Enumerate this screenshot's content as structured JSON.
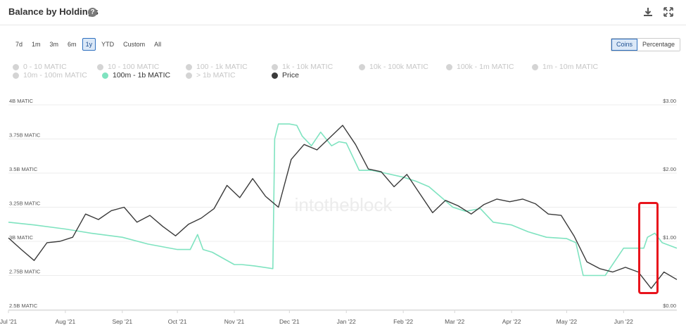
{
  "header": {
    "title": "Balance by Holdings",
    "help_icon": "question-circle-icon",
    "download_icon": "download-icon",
    "expand_icon": "expand-icon"
  },
  "periods": [
    "7d",
    "1m",
    "3m",
    "6m",
    "1y",
    "YTD",
    "Custom",
    "All"
  ],
  "active_period": "1y",
  "modes": [
    "Coins",
    "Percentage"
  ],
  "active_mode": "Coins",
  "legend": [
    {
      "label": "0 - 10 MATIC",
      "active": false
    },
    {
      "label": "10 - 100 MATIC",
      "active": false
    },
    {
      "label": "100 - 1k MATIC",
      "active": false
    },
    {
      "label": "1k - 10k MATIC",
      "active": false
    },
    {
      "label": "10k - 100k MATIC",
      "active": false
    },
    {
      "label": "100k - 1m MATIC",
      "active": false
    },
    {
      "label": "1m - 10m MATIC",
      "active": false
    },
    {
      "label": "10m - 100m MATIC",
      "active": false
    },
    {
      "label": "100m - 1b MATIC",
      "active": true
    },
    {
      "label": "> 1b MATIC",
      "active": false
    },
    {
      "label": "Price",
      "active": true
    }
  ],
  "watermark": "intotheblock",
  "colors": {
    "holdings_line": "#7fe3c0",
    "price_line": "#3a3a3a",
    "highlight_box": "#e8141c",
    "active_accent": "#2d6fbf"
  },
  "chart_data": {
    "type": "line",
    "x_tick_labels": [
      "Jul '21",
      "Aug '21",
      "Sep '21",
      "Oct '21",
      "Nov '21",
      "Dec '21",
      "Jan '22",
      "Feb '22",
      "Mar '22",
      "Apr '22",
      "May '22",
      "Jun '22"
    ],
    "x_range": [
      "2021-07-01",
      "2022-06-30"
    ],
    "y_left_tick_labels": [
      "4B MATIC",
      "3.75B MATIC",
      "3.5B MATIC",
      "3.25B MATIC",
      "3B MATIC",
      "2.75B MATIC",
      "2.5B MATIC"
    ],
    "y_left_ticks": [
      4,
      3.75,
      3.5,
      3.25,
      3,
      2.75,
      2.5
    ],
    "y_left_range": [
      2.5,
      4
    ],
    "y_right_tick_labels": [
      "$3.00",
      "$2.00",
      "$1.00",
      "$0.00"
    ],
    "y_right_ticks": [
      3,
      2,
      1,
      0
    ],
    "y_right_range": [
      0,
      3
    ],
    "grid": "horizontal",
    "series": [
      {
        "name": "100m - 1b MATIC",
        "axis": "left",
        "x": [
          "2021-07-01",
          "2021-07-15",
          "2021-08-01",
          "2021-08-15",
          "2021-09-01",
          "2021-09-15",
          "2021-10-01",
          "2021-10-08",
          "2021-10-12",
          "2021-10-15",
          "2021-10-20",
          "2021-11-01",
          "2021-11-05",
          "2021-11-12",
          "2021-11-22",
          "2021-11-23",
          "2021-11-25",
          "2021-12-01",
          "2021-12-05",
          "2021-12-08",
          "2021-12-13",
          "2021-12-18",
          "2021-12-24",
          "2021-12-28",
          "2022-01-01",
          "2022-01-08",
          "2022-01-15",
          "2022-01-22",
          "2022-02-01",
          "2022-02-08",
          "2022-02-15",
          "2022-02-28",
          "2022-03-07",
          "2022-03-15",
          "2022-03-22",
          "2022-04-01",
          "2022-04-10",
          "2022-04-20",
          "2022-05-01",
          "2022-05-06",
          "2022-05-10",
          "2022-05-15",
          "2022-05-22",
          "2022-06-01",
          "2022-06-08",
          "2022-06-12",
          "2022-06-14",
          "2022-06-18",
          "2022-06-22",
          "2022-06-30"
        ],
        "y": [
          3.14,
          3.12,
          3.09,
          3.06,
          3.03,
          2.98,
          2.94,
          2.94,
          3.05,
          2.94,
          2.92,
          2.83,
          2.83,
          2.82,
          2.8,
          3.75,
          3.86,
          3.86,
          3.85,
          3.77,
          3.7,
          3.8,
          3.7,
          3.73,
          3.72,
          3.52,
          3.52,
          3.5,
          3.47,
          3.44,
          3.4,
          3.25,
          3.22,
          3.24,
          3.14,
          3.12,
          3.07,
          3.03,
          3.02,
          2.99,
          2.75,
          2.75,
          2.75,
          2.95,
          2.95,
          2.95,
          3.03,
          3.06,
          2.99,
          2.95
        ]
      },
      {
        "name": "Price",
        "axis": "right",
        "x": [
          "2021-07-01",
          "2021-07-08",
          "2021-07-15",
          "2021-07-22",
          "2021-07-29",
          "2021-08-05",
          "2021-08-12",
          "2021-08-19",
          "2021-08-26",
          "2021-09-02",
          "2021-09-09",
          "2021-09-16",
          "2021-09-23",
          "2021-09-30",
          "2021-10-07",
          "2021-10-14",
          "2021-10-21",
          "2021-10-28",
          "2021-11-04",
          "2021-11-11",
          "2021-11-18",
          "2021-11-25",
          "2021-12-02",
          "2021-12-09",
          "2021-12-16",
          "2021-12-23",
          "2021-12-30",
          "2022-01-06",
          "2022-01-13",
          "2022-01-20",
          "2022-01-27",
          "2022-02-03",
          "2022-02-10",
          "2022-02-17",
          "2022-02-24",
          "2022-03-03",
          "2022-03-10",
          "2022-03-17",
          "2022-03-24",
          "2022-03-31",
          "2022-04-07",
          "2022-04-14",
          "2022-04-21",
          "2022-04-28",
          "2022-05-05",
          "2022-05-12",
          "2022-05-19",
          "2022-05-26",
          "2022-06-02",
          "2022-06-09",
          "2022-06-16",
          "2022-06-23",
          "2022-06-30"
        ],
        "y": [
          1.05,
          0.88,
          0.72,
          0.98,
          1.0,
          1.06,
          1.4,
          1.32,
          1.45,
          1.5,
          1.28,
          1.38,
          1.22,
          1.08,
          1.25,
          1.34,
          1.48,
          1.82,
          1.64,
          1.92,
          1.66,
          1.5,
          2.2,
          2.42,
          2.34,
          2.52,
          2.7,
          2.42,
          2.06,
          2.02,
          1.8,
          1.98,
          1.7,
          1.42,
          1.6,
          1.52,
          1.4,
          1.54,
          1.62,
          1.58,
          1.62,
          1.55,
          1.4,
          1.38,
          1.08,
          0.7,
          0.6,
          0.55,
          0.62,
          0.55,
          0.31,
          0.55,
          0.44
        ]
      }
    ]
  }
}
